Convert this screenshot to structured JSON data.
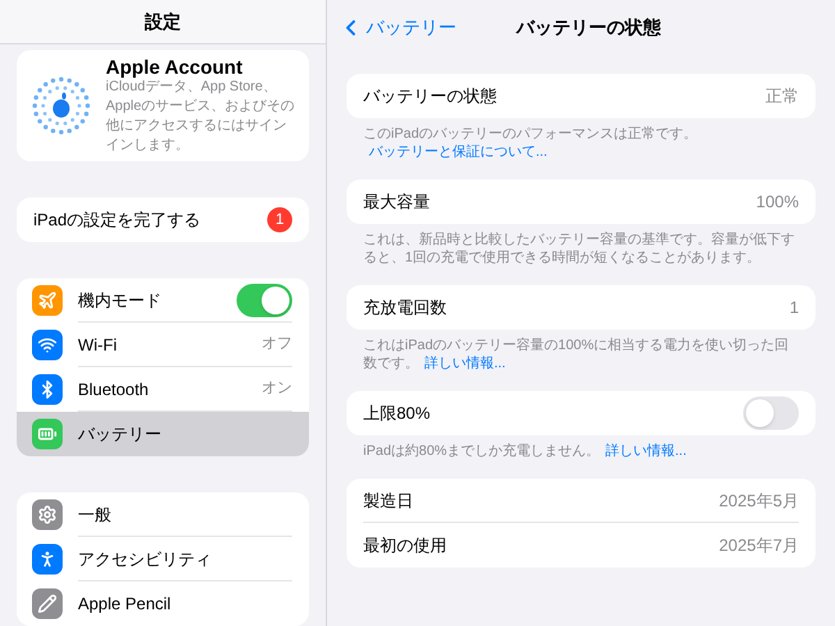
{
  "sidebar": {
    "title": "設定",
    "account": {
      "title": "Apple Account",
      "description": "iCloudデータ、App Store、Appleのサービス、およびその他にアクセスするにはサインインします。"
    },
    "setup": {
      "label": "iPadの設定を完了する",
      "badge": "1"
    },
    "groups": [
      [
        {
          "color": "#ff9500",
          "label": "機内モード",
          "kind": "toggle",
          "on": true,
          "selected": false
        },
        {
          "color": "#007aff",
          "label": "Wi-Fi",
          "kind": "value",
          "value": "オフ",
          "selected": false
        },
        {
          "color": "#007aff",
          "label": "Bluetooth",
          "kind": "value",
          "value": "オン",
          "selected": false
        },
        {
          "color": "#34c759",
          "label": "バッテリー",
          "kind": "plain",
          "selected": true
        }
      ],
      [
        {
          "color": "#8e8e93",
          "label": "一般",
          "kind": "plain",
          "selected": false
        },
        {
          "color": "#007aff",
          "label": "アクセシビリティ",
          "kind": "plain",
          "selected": false
        },
        {
          "color": "#8e8e93",
          "label": "Apple Pencil",
          "kind": "plain",
          "selected": false
        }
      ]
    ]
  },
  "detail": {
    "back": "バッテリー",
    "title": "バッテリーの状態",
    "sections": [
      {
        "rows": [
          {
            "label": "バッテリーの状態",
            "kind": "value",
            "value": "正常"
          }
        ],
        "footer": {
          "text": "このiPadのバッテリーのパフォーマンスは正常です。",
          "link": "バッテリーと保証について..."
        }
      },
      {
        "rows": [
          {
            "label": "最大容量",
            "kind": "value",
            "value": "100%"
          }
        ],
        "footer": {
          "text": "これは、新品時と比較したバッテリー容量の基準です。容量が低下すると、1回の充電で使用できる時間が短くなることがあります。"
        }
      },
      {
        "rows": [
          {
            "label": "充放電回数",
            "kind": "value",
            "value": "1"
          }
        ],
        "footer": {
          "text": "これはiPadのバッテリー容量の100%に相当する電力を使い切った回数です。",
          "link": "詳しい情報..."
        }
      },
      {
        "rows": [
          {
            "label": "上限80%",
            "kind": "toggle",
            "on": false
          }
        ],
        "footer": {
          "text": "iPadは約80%までしか充電しません。",
          "link": "詳しい情報..."
        }
      },
      {
        "rows": [
          {
            "label": "製造日",
            "kind": "value",
            "value": "2025年5月"
          },
          {
            "label": "最初の使用",
            "kind": "value",
            "value": "2025年7月"
          }
        ]
      }
    ]
  }
}
